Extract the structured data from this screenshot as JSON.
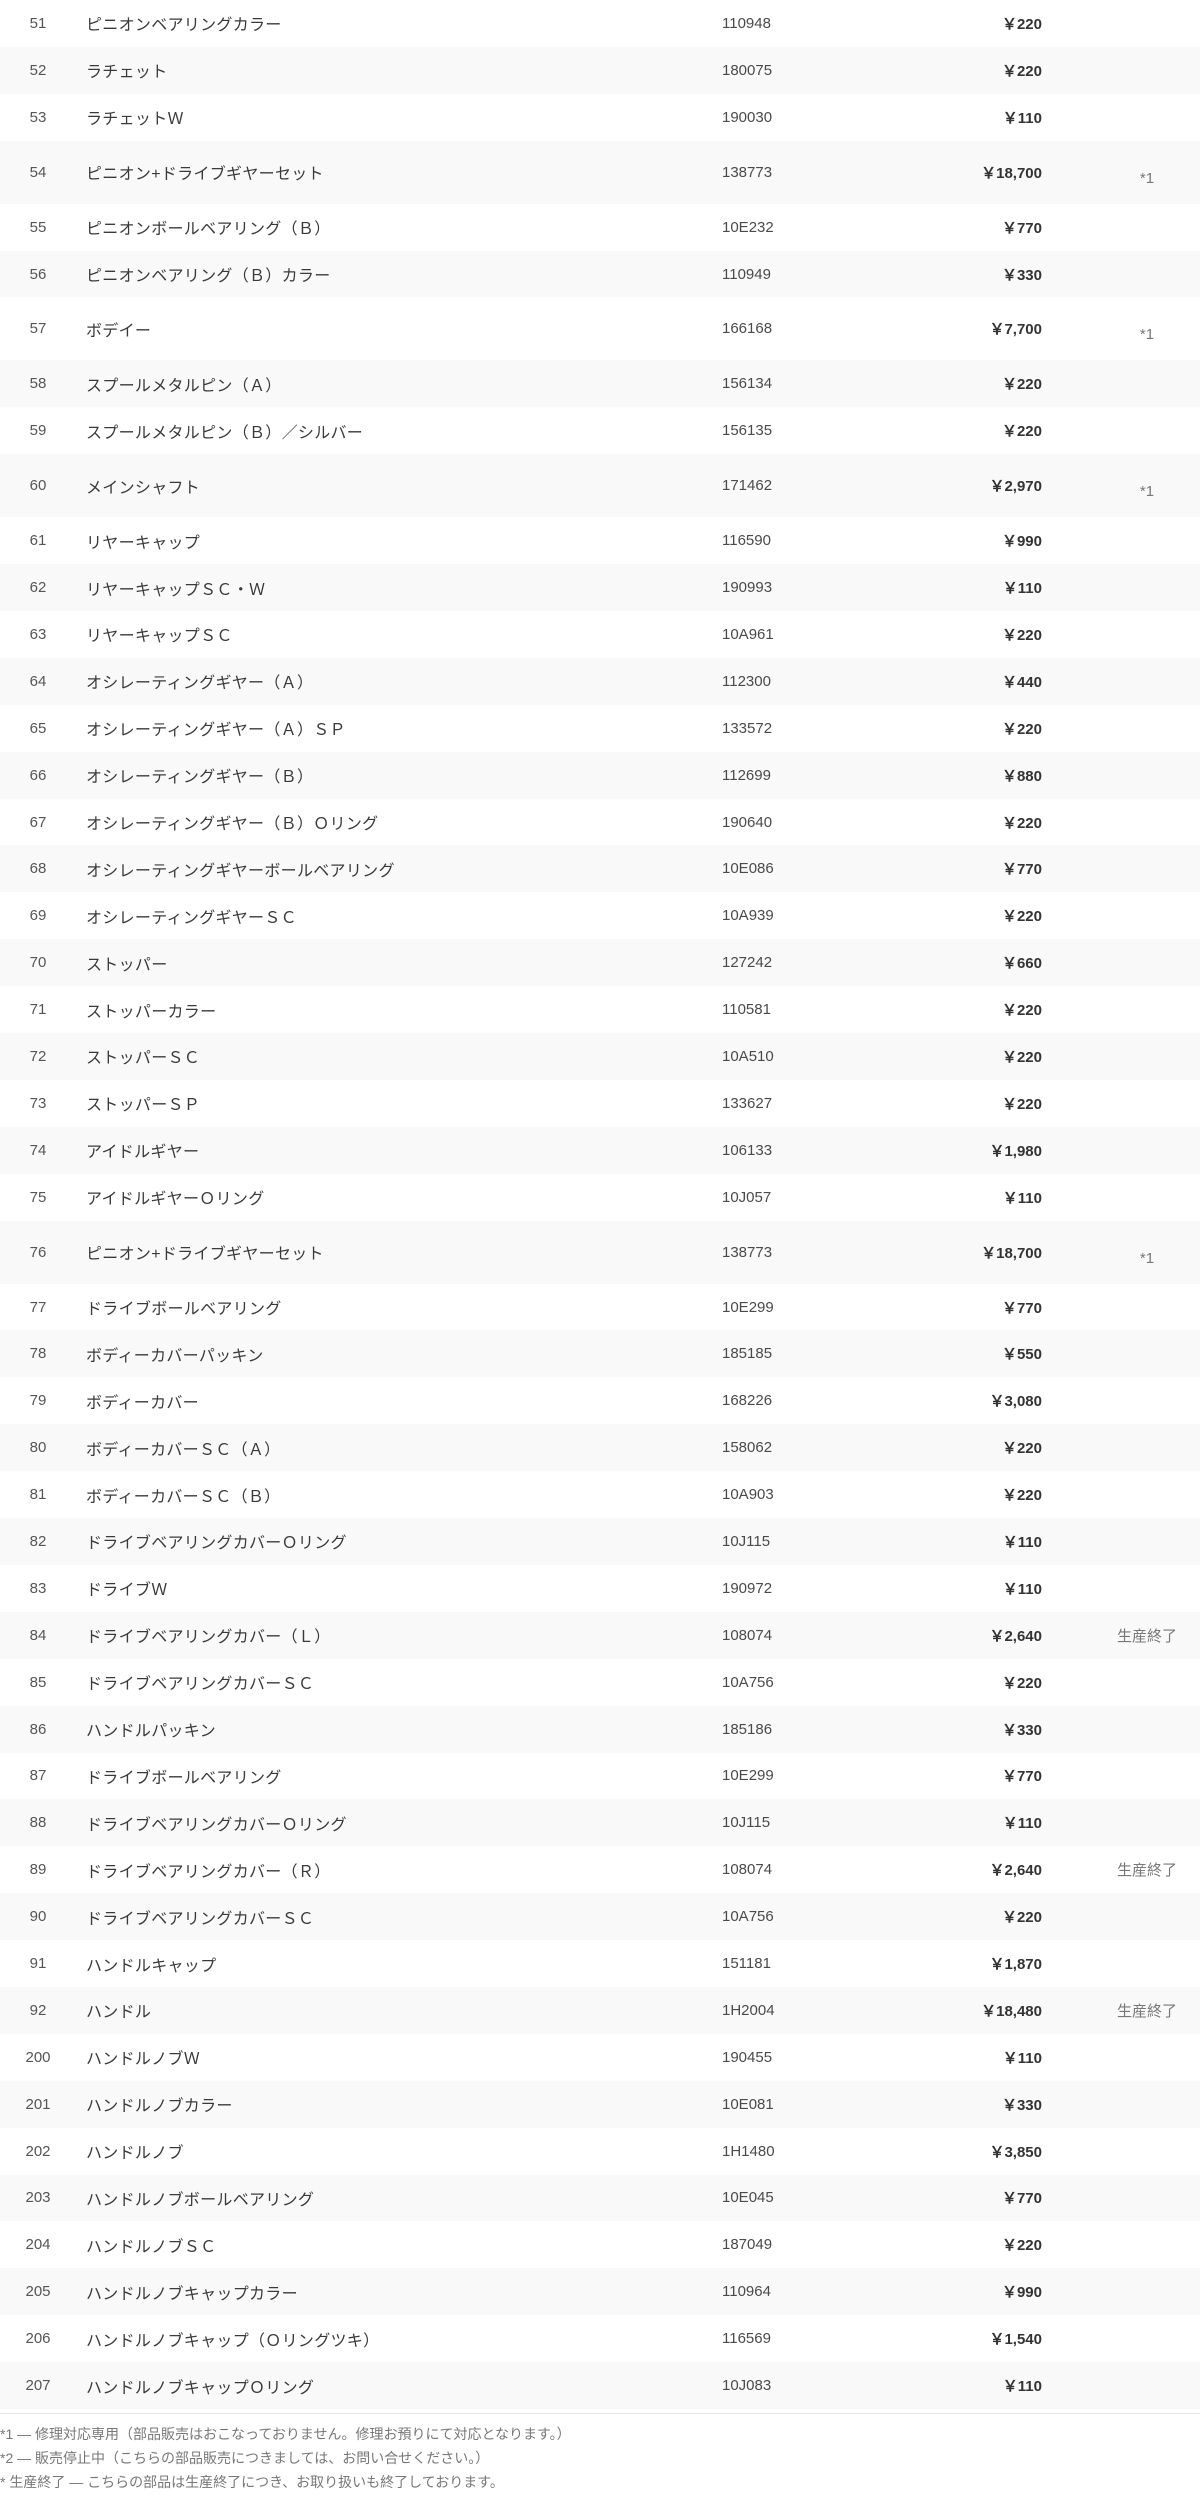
{
  "rows": [
    {
      "no": "51",
      "name": "ピニオンベアリングカラー",
      "code": "110948",
      "price": "￥220",
      "note": "",
      "tall": false
    },
    {
      "no": "52",
      "name": "ラチェット",
      "code": "180075",
      "price": "￥220",
      "note": "",
      "tall": false
    },
    {
      "no": "53",
      "name": "ラチェットＷ",
      "code": "190030",
      "price": "￥110",
      "note": "",
      "tall": false
    },
    {
      "no": "54",
      "name": "ピニオン+ドライブギヤーセット",
      "code": "138773",
      "price": "￥18,700",
      "note": "*1",
      "tall": true
    },
    {
      "no": "55",
      "name": "ピニオンボールベアリング（Ｂ）",
      "code": "10E232",
      "price": "￥770",
      "note": "",
      "tall": false
    },
    {
      "no": "56",
      "name": "ピニオンベアリング（Ｂ）カラー",
      "code": "110949",
      "price": "￥330",
      "note": "",
      "tall": false
    },
    {
      "no": "57",
      "name": "ボデイー",
      "code": "166168",
      "price": "￥7,700",
      "note": "*1",
      "tall": true
    },
    {
      "no": "58",
      "name": "スプールメタルピン（Ａ）",
      "code": "156134",
      "price": "￥220",
      "note": "",
      "tall": false
    },
    {
      "no": "59",
      "name": "スプールメタルピン（Ｂ）／シルバー",
      "code": "156135",
      "price": "￥220",
      "note": "",
      "tall": false
    },
    {
      "no": "60",
      "name": "メインシャフト",
      "code": "171462",
      "price": "￥2,970",
      "note": "*1",
      "tall": true
    },
    {
      "no": "61",
      "name": "リヤーキャップ",
      "code": "116590",
      "price": "￥990",
      "note": "",
      "tall": false
    },
    {
      "no": "62",
      "name": "リヤーキャップＳＣ・Ｗ",
      "code": "190993",
      "price": "￥110",
      "note": "",
      "tall": false
    },
    {
      "no": "63",
      "name": "リヤーキャップＳＣ",
      "code": "10A961",
      "price": "￥220",
      "note": "",
      "tall": false
    },
    {
      "no": "64",
      "name": "オシレーティングギヤー（Ａ）",
      "code": "112300",
      "price": "￥440",
      "note": "",
      "tall": false
    },
    {
      "no": "65",
      "name": "オシレーティングギヤー（Ａ）ＳＰ",
      "code": "133572",
      "price": "￥220",
      "note": "",
      "tall": false
    },
    {
      "no": "66",
      "name": "オシレーティングギヤー（Ｂ）",
      "code": "112699",
      "price": "￥880",
      "note": "",
      "tall": false
    },
    {
      "no": "67",
      "name": "オシレーティングギヤー（Ｂ）Ｏリング",
      "code": "190640",
      "price": "￥220",
      "note": "",
      "tall": false
    },
    {
      "no": "68",
      "name": "オシレーティングギヤーボールベアリング",
      "code": "10E086",
      "price": "￥770",
      "note": "",
      "tall": false
    },
    {
      "no": "69",
      "name": "オシレーティングギヤーＳＣ",
      "code": "10A939",
      "price": "￥220",
      "note": "",
      "tall": false
    },
    {
      "no": "70",
      "name": "ストッパー",
      "code": "127242",
      "price": "￥660",
      "note": "",
      "tall": false
    },
    {
      "no": "71",
      "name": "ストッパーカラー",
      "code": "110581",
      "price": "￥220",
      "note": "",
      "tall": false
    },
    {
      "no": "72",
      "name": "ストッパーＳＣ",
      "code": "10A510",
      "price": "￥220",
      "note": "",
      "tall": false
    },
    {
      "no": "73",
      "name": "ストッパーＳＰ",
      "code": "133627",
      "price": "￥220",
      "note": "",
      "tall": false
    },
    {
      "no": "74",
      "name": "アイドルギヤー",
      "code": "106133",
      "price": "￥1,980",
      "note": "",
      "tall": false
    },
    {
      "no": "75",
      "name": "アイドルギヤーＯリング",
      "code": "10J057",
      "price": "￥110",
      "note": "",
      "tall": false
    },
    {
      "no": "76",
      "name": "ピニオン+ドライブギヤーセット",
      "code": "138773",
      "price": "￥18,700",
      "note": "*1",
      "tall": true
    },
    {
      "no": "77",
      "name": "ドライブボールベアリング",
      "code": "10E299",
      "price": "￥770",
      "note": "",
      "tall": false
    },
    {
      "no": "78",
      "name": "ボディーカバーパッキン",
      "code": "185185",
      "price": "￥550",
      "note": "",
      "tall": false
    },
    {
      "no": "79",
      "name": "ボディーカバー",
      "code": "168226",
      "price": "￥3,080",
      "note": "",
      "tall": false
    },
    {
      "no": "80",
      "name": "ボディーカバーＳＣ（Ａ）",
      "code": "158062",
      "price": "￥220",
      "note": "",
      "tall": false
    },
    {
      "no": "81",
      "name": "ボディーカバーＳＣ（Ｂ）",
      "code": "10A903",
      "price": "￥220",
      "note": "",
      "tall": false
    },
    {
      "no": "82",
      "name": "ドライブベアリングカバーＯリング",
      "code": "10J115",
      "price": "￥110",
      "note": "",
      "tall": false
    },
    {
      "no": "83",
      "name": "ドライブＷ",
      "code": "190972",
      "price": "￥110",
      "note": "",
      "tall": false
    },
    {
      "no": "84",
      "name": "ドライブベアリングカバー（Ｌ）",
      "code": "108074",
      "price": "￥2,640",
      "note": "生産終了",
      "tall": false
    },
    {
      "no": "85",
      "name": "ドライブベアリングカバーＳＣ",
      "code": "10A756",
      "price": "￥220",
      "note": "",
      "tall": false
    },
    {
      "no": "86",
      "name": "ハンドルパッキン",
      "code": "185186",
      "price": "￥330",
      "note": "",
      "tall": false
    },
    {
      "no": "87",
      "name": "ドライブボールベアリング",
      "code": "10E299",
      "price": "￥770",
      "note": "",
      "tall": false
    },
    {
      "no": "88",
      "name": "ドライブベアリングカバーＯリング",
      "code": "10J115",
      "price": "￥110",
      "note": "",
      "tall": false
    },
    {
      "no": "89",
      "name": "ドライブベアリングカバー（Ｒ）",
      "code": "108074",
      "price": "￥2,640",
      "note": "生産終了",
      "tall": false
    },
    {
      "no": "90",
      "name": "ドライブベアリングカバーＳＣ",
      "code": "10A756",
      "price": "￥220",
      "note": "",
      "tall": false
    },
    {
      "no": "91",
      "name": "ハンドルキャップ",
      "code": "151181",
      "price": "￥1,870",
      "note": "",
      "tall": false
    },
    {
      "no": "92",
      "name": "ハンドル",
      "code": "1H2004",
      "price": "￥18,480",
      "note": "生産終了",
      "tall": false
    },
    {
      "no": "200",
      "name": "ハンドルノブＷ",
      "code": "190455",
      "price": "￥110",
      "note": "",
      "tall": false
    },
    {
      "no": "201",
      "name": "ハンドルノブカラー",
      "code": "10E081",
      "price": "￥330",
      "note": "",
      "tall": false
    },
    {
      "no": "202",
      "name": "ハンドルノブ",
      "code": "1H1480",
      "price": "￥3,850",
      "note": "",
      "tall": false
    },
    {
      "no": "203",
      "name": "ハンドルノブボールベアリング",
      "code": "10E045",
      "price": "￥770",
      "note": "",
      "tall": false
    },
    {
      "no": "204",
      "name": "ハンドルノブＳＣ",
      "code": "187049",
      "price": "￥220",
      "note": "",
      "tall": false
    },
    {
      "no": "205",
      "name": "ハンドルノブキャップカラー",
      "code": "110964",
      "price": "￥990",
      "note": "",
      "tall": false
    },
    {
      "no": "206",
      "name": "ハンドルノブキャップ（Ｏリングツキ）",
      "code": "116569",
      "price": "￥1,540",
      "note": "",
      "tall": false
    },
    {
      "no": "207",
      "name": "ハンドルノブキャップＯリング",
      "code": "10J083",
      "price": "￥110",
      "note": "",
      "tall": false
    }
  ],
  "footnotes": [
    "*1 ― 修理対応専用（部品販売はおこなっておりません。修理お預りにて対応となります。）",
    "*2 ― 販売停止中（こちらの部品販売につきましては、お問い合せください。）",
    "* 生産終了 ― こちらの部品は生産終了につき、お取り扱いも終了しております。"
  ]
}
